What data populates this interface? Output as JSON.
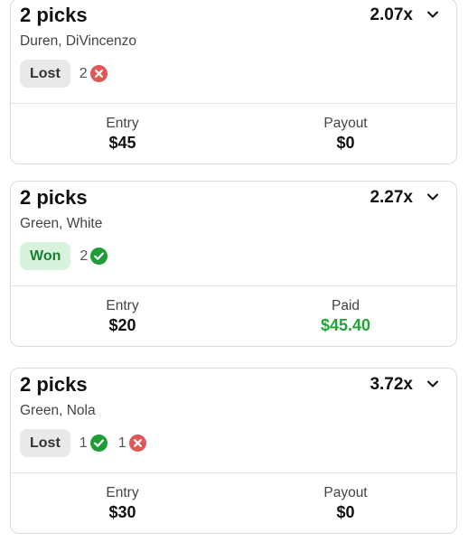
{
  "colors": {
    "won_badge_bg": "#d8f3dd",
    "won_text": "#1a7f2e",
    "paid_green": "#1ea534",
    "loss_red": "#e05757",
    "check_green": "#1e9c36",
    "lost_badge_bg": "#e9e9e9"
  },
  "entries": [
    {
      "title": "2 picks",
      "multiplier": "2.07x",
      "players": "Duren, DiVincenzo",
      "status": "Lost",
      "picks": [
        {
          "count": "2",
          "icon": "x-circle-icon"
        }
      ],
      "entry_label": "Entry",
      "entry_value": "$45",
      "payout_label": "Payout",
      "payout_value": "$0"
    },
    {
      "title": "2 picks",
      "multiplier": "2.27x",
      "players": "Green, White",
      "status": "Won",
      "picks": [
        {
          "count": "2",
          "icon": "check-circle-icon"
        }
      ],
      "entry_label": "Entry",
      "entry_value": "$20",
      "payout_label": "Paid",
      "payout_value": "$45.40"
    },
    {
      "title": "2 picks",
      "multiplier": "3.72x",
      "players": "Green, Nola",
      "status": "Lost",
      "picks": [
        {
          "count": "1",
          "icon": "check-circle-icon"
        },
        {
          "count": "1",
          "icon": "x-circle-icon"
        }
      ],
      "entry_label": "Entry",
      "entry_value": "$30",
      "payout_label": "Payout",
      "payout_value": "$0"
    }
  ]
}
